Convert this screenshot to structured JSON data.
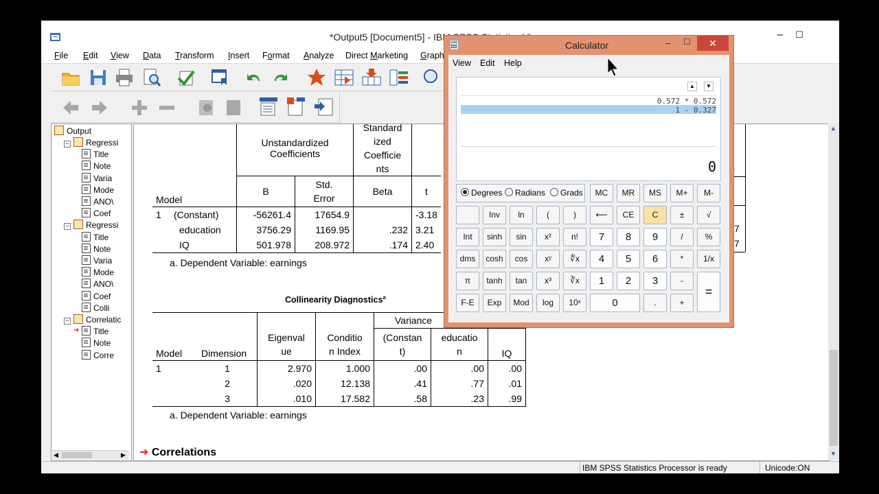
{
  "spss": {
    "title": "*Output5 [Document5] - IBM SPSS Statistics Vi",
    "menu": [
      {
        "pre": "",
        "u": "F",
        "post": "ile"
      },
      {
        "pre": "",
        "u": "E",
        "post": "dit"
      },
      {
        "pre": "",
        "u": "V",
        "post": "iew"
      },
      {
        "pre": "",
        "u": "D",
        "post": "ata"
      },
      {
        "pre": "",
        "u": "T",
        "post": "ransform"
      },
      {
        "pre": "",
        "u": "I",
        "post": "nsert"
      },
      {
        "pre": "F",
        "u": "o",
        "post": "rmat"
      },
      {
        "pre": "",
        "u": "A",
        "post": "nalyze"
      },
      {
        "pre": "Direct ",
        "u": "M",
        "post": "arketing"
      },
      {
        "pre": "",
        "u": "G",
        "post": "raph"
      }
    ],
    "minimize": "–",
    "maximize": "☐",
    "close": "✕",
    "status_ready": "IBM SPSS Statistics Processor is ready",
    "status_unicode": "Unicode:ON"
  },
  "outline": {
    "root": "Output",
    "items": [
      {
        "label": "Regressi",
        "level": 1,
        "type": "folder"
      },
      {
        "label": "Title",
        "level": 2,
        "type": "page"
      },
      {
        "label": "Note",
        "level": 2,
        "type": "page"
      },
      {
        "label": "Varia",
        "level": 2,
        "type": "page"
      },
      {
        "label": "Mode",
        "level": 2,
        "type": "page"
      },
      {
        "label": "ANO\\",
        "level": 2,
        "type": "page"
      },
      {
        "label": "Coef",
        "level": 2,
        "type": "page"
      },
      {
        "label": "Regressi",
        "level": 1,
        "type": "folder"
      },
      {
        "label": "Title",
        "level": 2,
        "type": "page"
      },
      {
        "label": "Note",
        "level": 2,
        "type": "page"
      },
      {
        "label": "Varia",
        "level": 2,
        "type": "page"
      },
      {
        "label": "Mode",
        "level": 2,
        "type": "page"
      },
      {
        "label": "ANO\\",
        "level": 2,
        "type": "page"
      },
      {
        "label": "Coef",
        "level": 2,
        "type": "page"
      },
      {
        "label": "Colli",
        "level": 2,
        "type": "page"
      },
      {
        "label": "Correlatic",
        "level": 1,
        "type": "folder"
      },
      {
        "label": "Title",
        "level": 2,
        "type": "page",
        "selected": true
      },
      {
        "label": "Note",
        "level": 2,
        "type": "page"
      },
      {
        "label": "Corre",
        "level": 2,
        "type": "page"
      }
    ]
  },
  "coef": {
    "h_std_top": "Standard",
    "h_std_mid1": "ized",
    "h_std_mid2": "Coefficie",
    "h_std_bot": "nts",
    "h_unstd1": "Unstandardized",
    "h_unstd2": "Coefficients",
    "h_model": "Model",
    "h_b": "B",
    "h_se1": "Std.",
    "h_se2": "Error",
    "h_beta": "Beta",
    "h_t": "t",
    "rows": [
      {
        "model": "1",
        "var": "(Constant)",
        "b": "-56261.4",
        "se": "17654.9",
        "beta": "",
        "t": "-3.18"
      },
      {
        "model": "",
        "var": "education",
        "b": "3756.29",
        "se": "1169.95",
        "beta": ".232",
        "t": "3.21"
      },
      {
        "model": "",
        "var": "IQ",
        "b": "501.978",
        "se": "208.972",
        "beta": ".174",
        "t": "2.40"
      }
    ],
    "right_col_head": "s",
    "right_col": [
      "",
      "7",
      "7"
    ],
    "footnote": "a. Dependent Variable: earnings"
  },
  "coll": {
    "title": "Collinearity Diagnostics",
    "title_sup": "a",
    "h_model": "Model",
    "h_dim": "Dimension",
    "h_eig1": "Eigenval",
    "h_eig2": "ue",
    "h_ci1": "Conditio",
    "h_ci2": "n Index",
    "h_var": "Variance",
    "h_const1": "(Constan",
    "h_const2": "t)",
    "h_edu1": "educatio",
    "h_edu2": "n",
    "h_iq": "IQ",
    "rows": [
      {
        "model": "1",
        "dim": "1",
        "eig": "2.970",
        "ci": "1.000",
        "c": ".00",
        "e": ".00",
        "iq": ".00"
      },
      {
        "model": "",
        "dim": "2",
        "eig": ".020",
        "ci": "12.138",
        "c": ".41",
        "e": ".77",
        "iq": ".01"
      },
      {
        "model": "",
        "dim": "3",
        "eig": ".010",
        "ci": "17.582",
        "c": ".58",
        "e": ".23",
        "iq": ".99"
      }
    ],
    "footnote": "a. Dependent Variable: earnings"
  },
  "correlations_heading": "Correlations",
  "calc": {
    "title": "Calculator",
    "menu": [
      "View",
      "Edit",
      "Help"
    ],
    "history": [
      "0.572 * 0.572",
      "1 - 0.327"
    ],
    "display": "0",
    "modes": [
      {
        "label": "Degrees",
        "on": true
      },
      {
        "label": "Radians",
        "on": false
      },
      {
        "label": "Grads",
        "on": false
      }
    ],
    "keys": {
      "mc": "MC",
      "mr": "MR",
      "ms": "MS",
      "mplus": "M+",
      "mminus": "M-",
      "inv": "Inv",
      "ln": "ln",
      "lparen": "(",
      "rparen": ")",
      "back": "⟵",
      "ce": "CE",
      "c": "C",
      "pm": "±",
      "sqrt": "√",
      "int": "Int",
      "sinh": "sinh",
      "sin": "sin",
      "x2": "x²",
      "fact": "n!",
      "k7": "7",
      "k8": "8",
      "k9": "9",
      "div": "/",
      "pct": "%",
      "dms": "dms",
      "cosh": "cosh",
      "cos": "cos",
      "xy": "xʸ",
      "yroot": "∜x",
      "k4": "4",
      "k5": "5",
      "k6": "6",
      "mul": "*",
      "recip": "1/x",
      "pi": "π",
      "tanh": "tanh",
      "tan": "tan",
      "x3": "x³",
      "croot": "∛x",
      "k1": "1",
      "k2": "2",
      "k3": "3",
      "sub": "-",
      "eq": "=",
      "fe": "F-E",
      "exp": "Exp",
      "mod": "Mod",
      "log": "log",
      "tenx": "10ˣ",
      "k0": "0",
      "dot": ".",
      "add": "+"
    }
  },
  "colors": {
    "calc_frame": "#e3916e",
    "calc_close": "#c9483b",
    "history_highlight": "#abd1f2",
    "c_key": "#fbe1a6"
  }
}
